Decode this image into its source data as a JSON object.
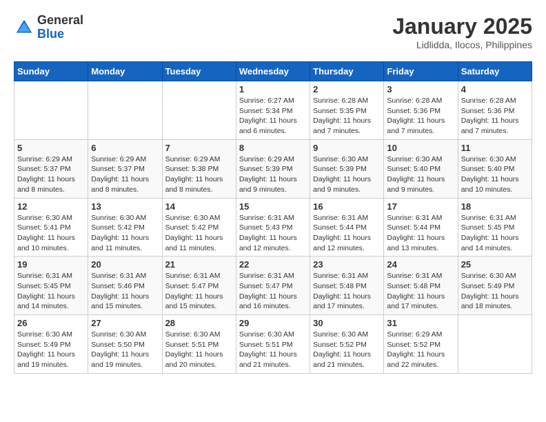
{
  "header": {
    "logo_general": "General",
    "logo_blue": "Blue",
    "month_title": "January 2025",
    "subtitle": "Lidlidda, Ilocos, Philippines"
  },
  "weekdays": [
    "Sunday",
    "Monday",
    "Tuesday",
    "Wednesday",
    "Thursday",
    "Friday",
    "Saturday"
  ],
  "weeks": [
    [
      {
        "day": "",
        "sunrise": "",
        "sunset": "",
        "daylight": ""
      },
      {
        "day": "",
        "sunrise": "",
        "sunset": "",
        "daylight": ""
      },
      {
        "day": "",
        "sunrise": "",
        "sunset": "",
        "daylight": ""
      },
      {
        "day": "1",
        "sunrise": "6:27 AM",
        "sunset": "5:34 PM",
        "daylight": "11 hours and 6 minutes."
      },
      {
        "day": "2",
        "sunrise": "6:28 AM",
        "sunset": "5:35 PM",
        "daylight": "11 hours and 7 minutes."
      },
      {
        "day": "3",
        "sunrise": "6:28 AM",
        "sunset": "5:36 PM",
        "daylight": "11 hours and 7 minutes."
      },
      {
        "day": "4",
        "sunrise": "6:28 AM",
        "sunset": "5:36 PM",
        "daylight": "11 hours and 7 minutes."
      }
    ],
    [
      {
        "day": "5",
        "sunrise": "6:29 AM",
        "sunset": "5:37 PM",
        "daylight": "11 hours and 8 minutes."
      },
      {
        "day": "6",
        "sunrise": "6:29 AM",
        "sunset": "5:37 PM",
        "daylight": "11 hours and 8 minutes."
      },
      {
        "day": "7",
        "sunrise": "6:29 AM",
        "sunset": "5:38 PM",
        "daylight": "11 hours and 8 minutes."
      },
      {
        "day": "8",
        "sunrise": "6:29 AM",
        "sunset": "5:39 PM",
        "daylight": "11 hours and 9 minutes."
      },
      {
        "day": "9",
        "sunrise": "6:30 AM",
        "sunset": "5:39 PM",
        "daylight": "11 hours and 9 minutes."
      },
      {
        "day": "10",
        "sunrise": "6:30 AM",
        "sunset": "5:40 PM",
        "daylight": "11 hours and 9 minutes."
      },
      {
        "day": "11",
        "sunrise": "6:30 AM",
        "sunset": "5:40 PM",
        "daylight": "11 hours and 10 minutes."
      }
    ],
    [
      {
        "day": "12",
        "sunrise": "6:30 AM",
        "sunset": "5:41 PM",
        "daylight": "11 hours and 10 minutes."
      },
      {
        "day": "13",
        "sunrise": "6:30 AM",
        "sunset": "5:42 PM",
        "daylight": "11 hours and 11 minutes."
      },
      {
        "day": "14",
        "sunrise": "6:30 AM",
        "sunset": "5:42 PM",
        "daylight": "11 hours and 11 minutes."
      },
      {
        "day": "15",
        "sunrise": "6:31 AM",
        "sunset": "5:43 PM",
        "daylight": "11 hours and 12 minutes."
      },
      {
        "day": "16",
        "sunrise": "6:31 AM",
        "sunset": "5:44 PM",
        "daylight": "11 hours and 12 minutes."
      },
      {
        "day": "17",
        "sunrise": "6:31 AM",
        "sunset": "5:44 PM",
        "daylight": "11 hours and 13 minutes."
      },
      {
        "day": "18",
        "sunrise": "6:31 AM",
        "sunset": "5:45 PM",
        "daylight": "11 hours and 14 minutes."
      }
    ],
    [
      {
        "day": "19",
        "sunrise": "6:31 AM",
        "sunset": "5:45 PM",
        "daylight": "11 hours and 14 minutes."
      },
      {
        "day": "20",
        "sunrise": "6:31 AM",
        "sunset": "5:46 PM",
        "daylight": "11 hours and 15 minutes."
      },
      {
        "day": "21",
        "sunrise": "6:31 AM",
        "sunset": "5:47 PM",
        "daylight": "11 hours and 15 minutes."
      },
      {
        "day": "22",
        "sunrise": "6:31 AM",
        "sunset": "5:47 PM",
        "daylight": "11 hours and 16 minutes."
      },
      {
        "day": "23",
        "sunrise": "6:31 AM",
        "sunset": "5:48 PM",
        "daylight": "11 hours and 17 minutes."
      },
      {
        "day": "24",
        "sunrise": "6:31 AM",
        "sunset": "5:48 PM",
        "daylight": "11 hours and 17 minutes."
      },
      {
        "day": "25",
        "sunrise": "6:30 AM",
        "sunset": "5:49 PM",
        "daylight": "11 hours and 18 minutes."
      }
    ],
    [
      {
        "day": "26",
        "sunrise": "6:30 AM",
        "sunset": "5:49 PM",
        "daylight": "11 hours and 19 minutes."
      },
      {
        "day": "27",
        "sunrise": "6:30 AM",
        "sunset": "5:50 PM",
        "daylight": "11 hours and 19 minutes."
      },
      {
        "day": "28",
        "sunrise": "6:30 AM",
        "sunset": "5:51 PM",
        "daylight": "11 hours and 20 minutes."
      },
      {
        "day": "29",
        "sunrise": "6:30 AM",
        "sunset": "5:51 PM",
        "daylight": "11 hours and 21 minutes."
      },
      {
        "day": "30",
        "sunrise": "6:30 AM",
        "sunset": "5:52 PM",
        "daylight": "11 hours and 21 minutes."
      },
      {
        "day": "31",
        "sunrise": "6:29 AM",
        "sunset": "5:52 PM",
        "daylight": "11 hours and 22 minutes."
      },
      {
        "day": "",
        "sunrise": "",
        "sunset": "",
        "daylight": ""
      }
    ]
  ]
}
